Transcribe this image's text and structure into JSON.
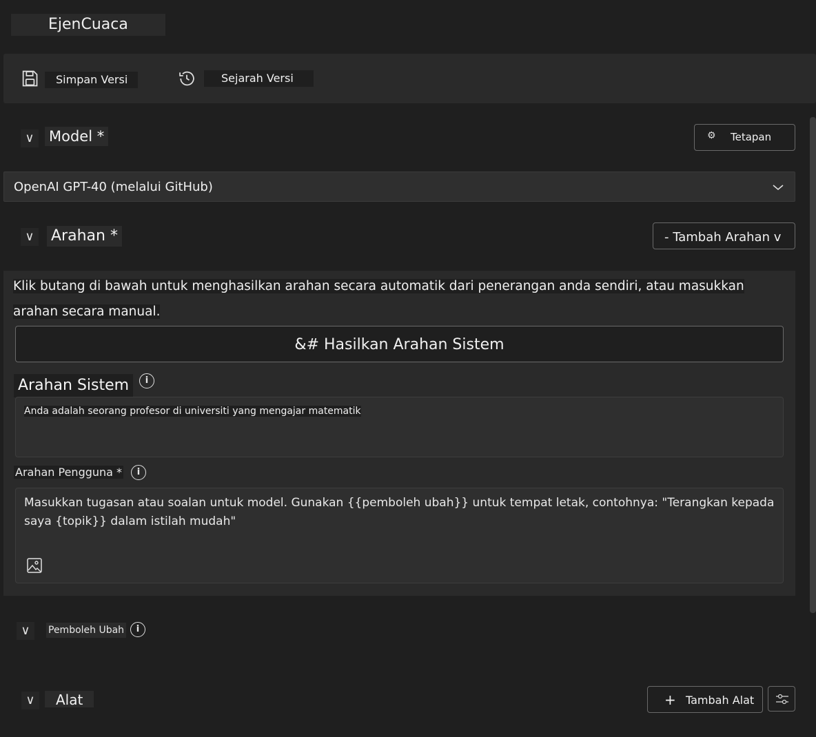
{
  "app": {
    "title": "EjenCuaca"
  },
  "toolbar": {
    "save_label": "Simpan Versi",
    "history_label": "Sejarah Versi"
  },
  "model_section": {
    "title": "Model *",
    "settings_label": "Tetapan",
    "selected_model": "OpenAI GPT-40 (melalui GitHub)"
  },
  "prompt_section": {
    "title": "Arahan *",
    "add_prompt_label": "- Tambah Arahan v",
    "hint": "Klik butang di bawah untuk menghasilkan arahan secara automatik dari penerangan anda sendiri, atau masukkan arahan secara manual.",
    "generate_label": "&# Hasilkan Arahan Sistem",
    "system_title": "Arahan Sistem",
    "system_value": "Anda adalah seorang profesor di universiti yang mengajar matematik",
    "user_title": "Arahan Pengguna *",
    "user_placeholder": "Masukkan tugasan atau soalan untuk model. Gunakan {{pemboleh ubah}} untuk tempat letak, contohnya: \"Terangkan kepada saya {topik}} dalam istilah mudah\""
  },
  "variables_section": {
    "title": "Pemboleh Ubah"
  },
  "tools_section": {
    "title": "Alat",
    "add_tool_label": "Tambah Alat"
  },
  "icons": {
    "collapse": "chevron-icon",
    "save": "save-icon",
    "history": "history-icon",
    "info": "info-icon",
    "image": "image-icon",
    "plus": "plus-icon"
  }
}
